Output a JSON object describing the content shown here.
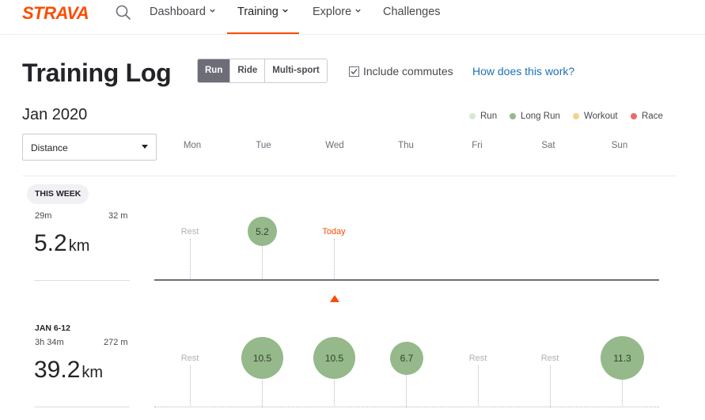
{
  "nav": {
    "logo": "STRAVA",
    "items": [
      {
        "label": "Dashboard",
        "has_menu": true
      },
      {
        "label": "Training",
        "has_menu": true,
        "active": true
      },
      {
        "label": "Explore",
        "has_menu": true
      },
      {
        "label": "Challenges",
        "has_menu": false
      }
    ]
  },
  "header": {
    "title": "Training Log",
    "sports": [
      "Run",
      "Ride",
      "Multi-sport"
    ],
    "selected_sport": "Run",
    "include_commutes_label": "Include commutes",
    "include_commutes_checked": true,
    "help_link": "How does this work?"
  },
  "month": "Jan 2020",
  "legend": [
    {
      "label": "Run",
      "color": "#d9e7d4"
    },
    {
      "label": "Long Run",
      "color": "#95b98a"
    },
    {
      "label": "Workout",
      "color": "#f8d08a"
    },
    {
      "label": "Race",
      "color": "#e66c6c"
    }
  ],
  "metric_select": {
    "value": "Distance"
  },
  "days": [
    "Mon",
    "Tue",
    "Wed",
    "Thu",
    "Fri",
    "Sat",
    "Sun"
  ],
  "colors": {
    "brand": "#fc4c02",
    "long_run": "#95b98a",
    "link": "#1d71b8"
  },
  "weeks": [
    {
      "label": "THIS WEEK",
      "time": "29m",
      "elevation": "32 m",
      "distance": "5.2",
      "unit": "km",
      "today_label": "Today",
      "days": [
        {
          "type": "rest",
          "label": "Rest"
        },
        {
          "type": "activity",
          "value": "5.2"
        },
        {
          "type": "today",
          "label": "Today"
        }
      ]
    },
    {
      "label": "JAN 6-12",
      "time": "3h 34m",
      "elevation": "272 m",
      "distance": "39.2",
      "unit": "km",
      "days": [
        {
          "type": "rest",
          "label": "Rest"
        },
        {
          "type": "activity",
          "value": "10.5"
        },
        {
          "type": "activity",
          "value": "10.5"
        },
        {
          "type": "activity",
          "value": "6.7"
        },
        {
          "type": "rest",
          "label": "Rest"
        },
        {
          "type": "rest",
          "label": "Rest"
        },
        {
          "type": "activity",
          "value": "11.3"
        }
      ]
    }
  ]
}
